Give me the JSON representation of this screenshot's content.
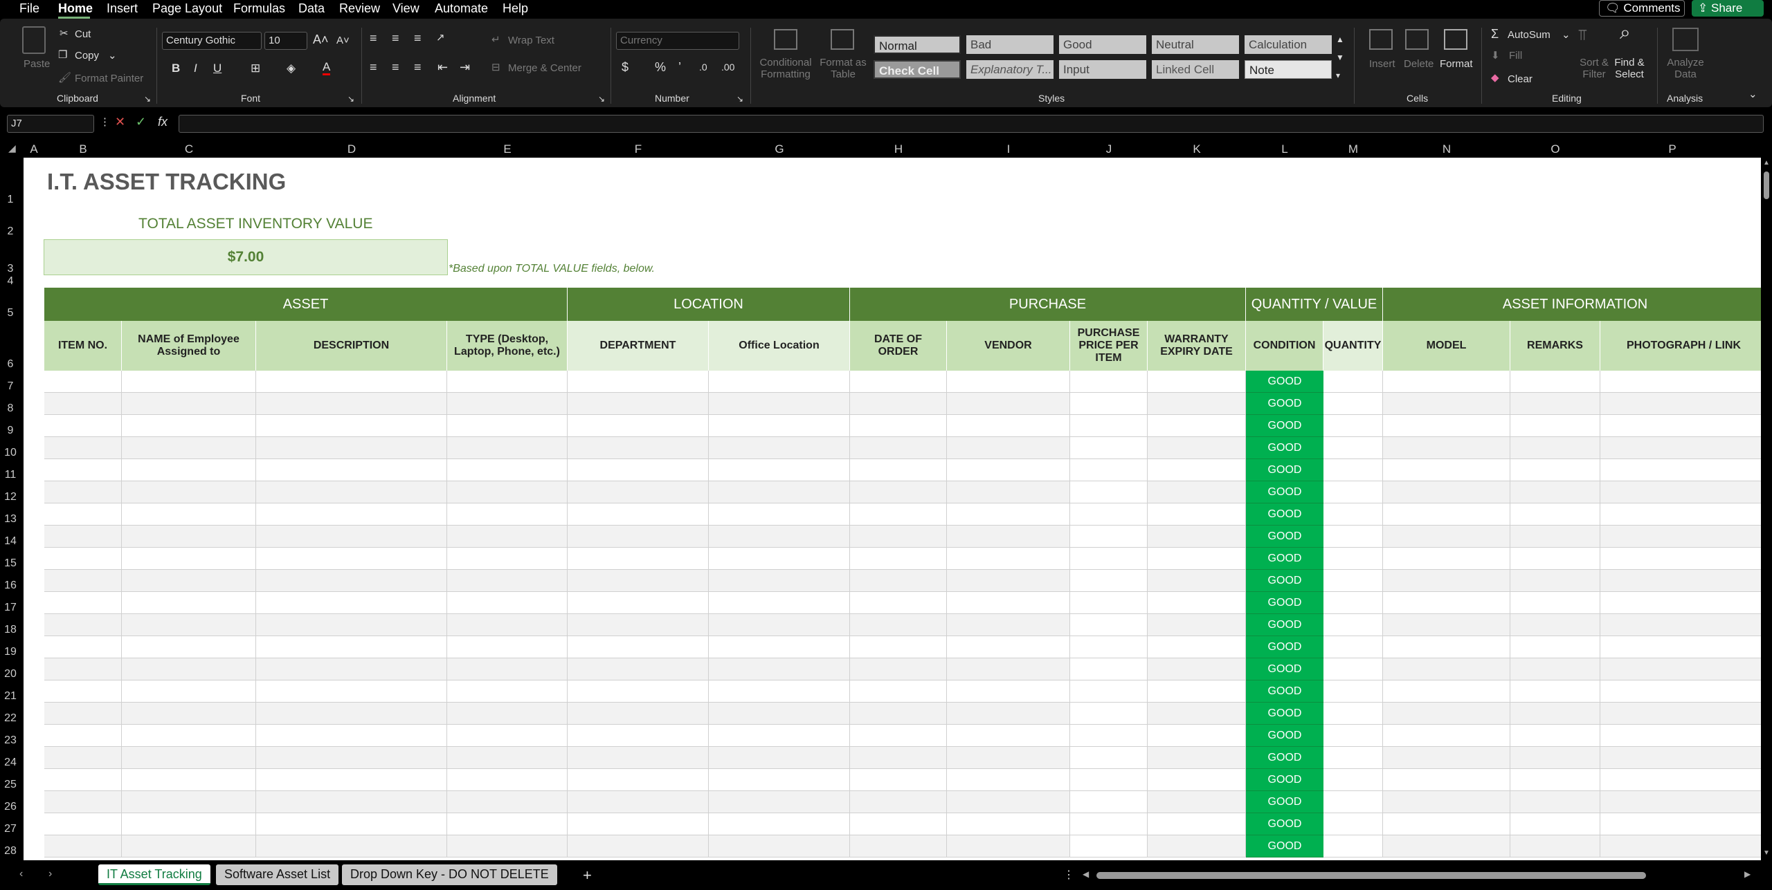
{
  "menu": {
    "items": [
      "File",
      "Home",
      "Insert",
      "Page Layout",
      "Formulas",
      "Data",
      "Review",
      "View",
      "Automate",
      "Help"
    ],
    "comments": "Comments",
    "share": "Share"
  },
  "ribbon": {
    "clipboard": {
      "paste": "Paste",
      "cut": "Cut",
      "copy": "Copy",
      "format_painter": "Format Painter",
      "label": "Clipboard"
    },
    "font": {
      "name": "Century Gothic",
      "size": "10",
      "label": "Font"
    },
    "alignment": {
      "wrap": "Wrap Text",
      "merge": "Merge & Center",
      "label": "Alignment"
    },
    "number": {
      "format": "Currency",
      "label": "Number"
    },
    "styles": {
      "cond": "Conditional Formatting",
      "table": "Format as Table",
      "label": "Styles",
      "cells": [
        "Normal",
        "Bad",
        "Good",
        "Neutral",
        "Calculation",
        "Check Cell",
        "Explanatory T...",
        "Input",
        "Linked Cell",
        "Note"
      ]
    },
    "cells": {
      "insert": "Insert",
      "delete": "Delete",
      "format": "Format",
      "label": "Cells"
    },
    "editing": {
      "autosum": "AutoSum",
      "fill": "Fill",
      "clear": "Clear",
      "sort": "Sort & Filter",
      "find": "Find & Select",
      "label": "Editing"
    },
    "analysis": {
      "analyze": "Analyze Data",
      "label": "Analysis"
    }
  },
  "formula_bar": {
    "name_box": "J7",
    "fx": "fx",
    "value": ""
  },
  "columns": [
    "A",
    "B",
    "C",
    "D",
    "E",
    "F",
    "G",
    "H",
    "I",
    "J",
    "K",
    "L",
    "M",
    "N",
    "O",
    "P"
  ],
  "rows": [
    "1",
    "2",
    "3",
    "4",
    "5",
    "6",
    "7",
    "8",
    "9",
    "10",
    "11",
    "12",
    "13",
    "14",
    "15",
    "16",
    "17",
    "18",
    "19",
    "20",
    "21",
    "22",
    "23",
    "24",
    "25",
    "26",
    "27",
    "28"
  ],
  "sheet": {
    "title": "I.T. ASSET TRACKING",
    "total_label": "TOTAL ASSET INVENTORY VALUE",
    "total_value": "$7.00",
    "note": "*Based upon TOTAL VALUE fields, below.",
    "groups": [
      "ASSET",
      "LOCATION",
      "PURCHASE",
      "QUANTITY / VALUE",
      "ASSET INFORMATION"
    ],
    "headers": [
      "ITEM NO.",
      "NAME of Employee Assigned to",
      "DESCRIPTION",
      "TYPE (Desktop, Laptop, Phone, etc.)",
      "DEPARTMENT",
      "Office Location",
      "DATE OF ORDER",
      "VENDOR",
      "PURCHASE PRICE PER ITEM",
      "WARRANTY EXPIRY DATE",
      "CONDITION",
      "QUANTITY",
      "MODEL",
      "REMARKS",
      "PHOTOGRAPH / LINK"
    ],
    "condition_value": "GOOD"
  },
  "tabs": [
    "IT Asset Tracking",
    "Software Asset List",
    "Drop Down Key - DO NOT DELETE"
  ],
  "colors": {
    "accent": "#538135",
    "header_light": "#c6e0b4",
    "good": "#00b050",
    "title": "#595959"
  }
}
